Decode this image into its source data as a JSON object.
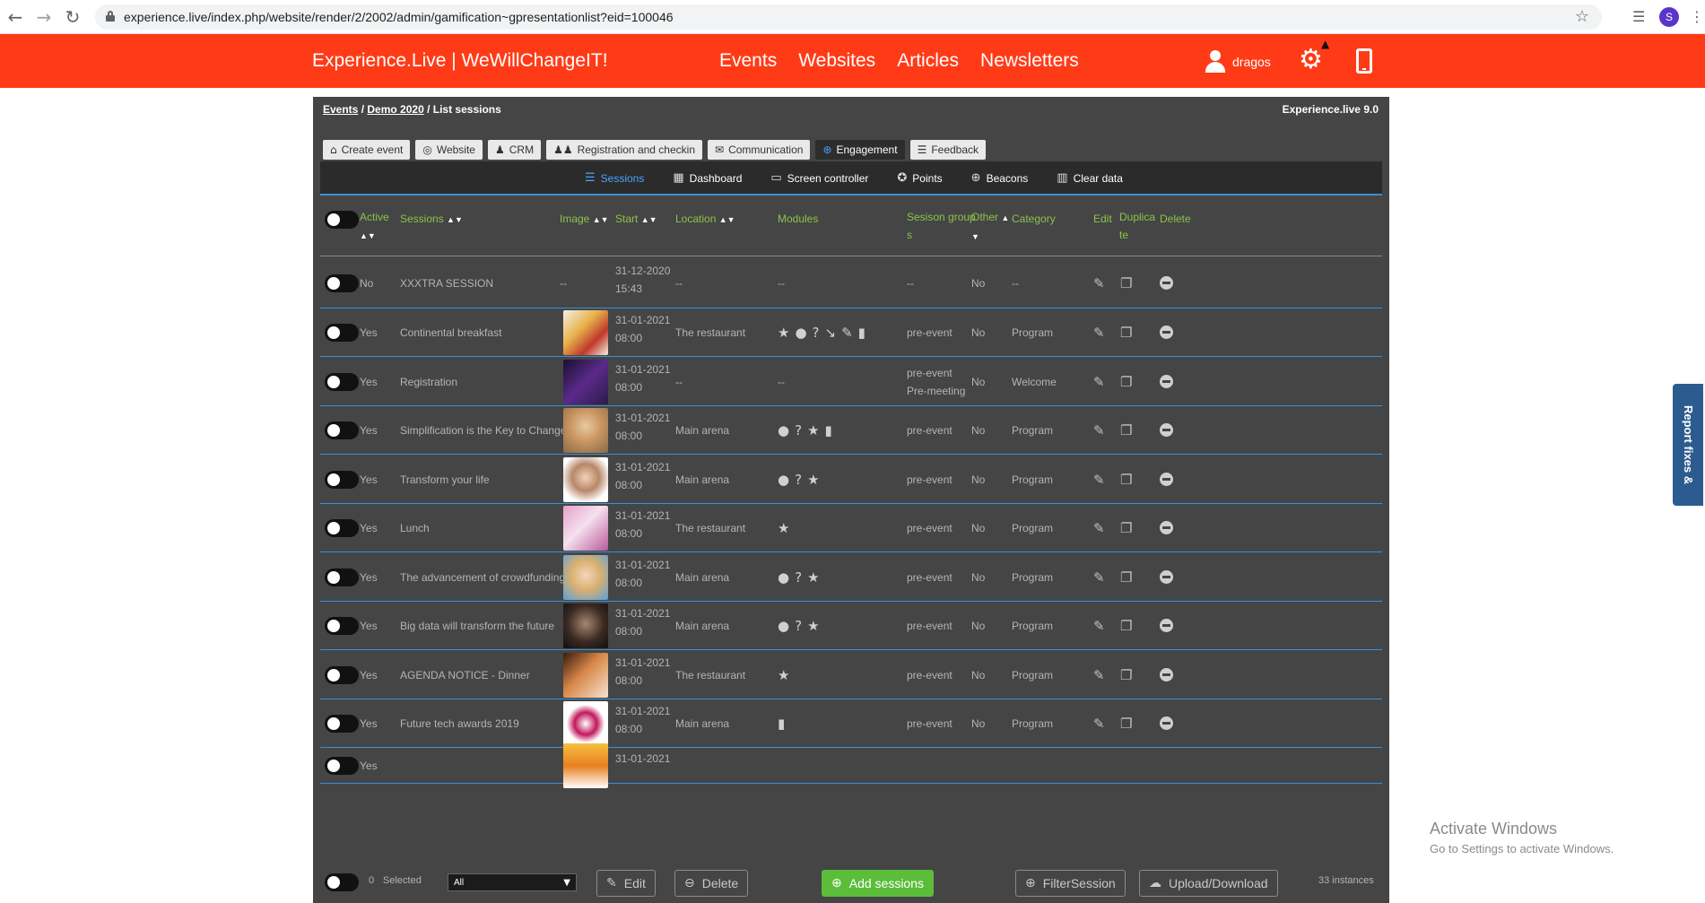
{
  "browser": {
    "url": "experience.live/index.php/website/render/2/2002/admin/gamification~gpresentationlist?eid=100046",
    "profile_initial": "S"
  },
  "header": {
    "brand": "Experience.Live | WeWillChangeIT!",
    "nav": [
      "Events",
      "Websites",
      "Articles",
      "Newsletters"
    ],
    "username": "dragos"
  },
  "breadcrumb": {
    "events": "Events",
    "sep1": " / ",
    "demo": "Demo 2020",
    "sep2": " / ",
    "current": "List sessions",
    "version": "Experience.live 9.0"
  },
  "tabs": [
    {
      "label": "Create event",
      "icon": "house-icon",
      "glyph": "⌂"
    },
    {
      "label": "Website",
      "icon": "globe-icon",
      "glyph": "◎"
    },
    {
      "label": "CRM",
      "icon": "user-icon",
      "glyph": "♟"
    },
    {
      "label": "Registration and checkin",
      "icon": "people-icon",
      "glyph": "♟♟"
    },
    {
      "label": "Communication",
      "icon": "envelope-icon",
      "glyph": "✉"
    },
    {
      "label": "Engagement",
      "icon": "gamepad-icon",
      "glyph": "⊛",
      "active": true
    },
    {
      "label": "Feedback",
      "icon": "list-icon",
      "glyph": "☰"
    }
  ],
  "subnav": [
    {
      "label": "Sessions",
      "icon": "list-icon",
      "glyph": "☰",
      "active": true
    },
    {
      "label": "Dashboard",
      "icon": "dashboard-icon",
      "glyph": "▦"
    },
    {
      "label": "Screen controller",
      "icon": "laptop-icon",
      "glyph": "▭"
    },
    {
      "label": "Points",
      "icon": "trophy-icon",
      "glyph": "✪"
    },
    {
      "label": "Beacons",
      "icon": "target-icon",
      "glyph": "⊕"
    },
    {
      "label": "Clear data",
      "icon": "trash-icon",
      "glyph": "▥"
    }
  ],
  "columns": {
    "active": "Active",
    "sessions": "Sessions",
    "image": "Image",
    "start": "Start",
    "location": "Location",
    "modules": "Modules",
    "session_group_1": "Sesison group",
    "session_group_2": "s",
    "other": "Other",
    "category": "Category",
    "edit": "Edit",
    "duplicate_1": "Duplica",
    "duplicate_2": "te",
    "delete": "Delete"
  },
  "rows": [
    {
      "active": "No",
      "name": "XXXTRA SESSION",
      "image": "--",
      "date": "31-12-2020",
      "time": "15:43",
      "location": "--",
      "modules": [
        "--"
      ],
      "group": "--",
      "group2": "",
      "other": "No",
      "category": "--"
    },
    {
      "active": "Yes",
      "name": "Continental breakfast",
      "image": "breakfast",
      "date": "31-01-2021",
      "time": "08:00",
      "location": "The restaurant",
      "modules": [
        "★",
        "●",
        "?",
        "↘",
        "✎",
        "▮"
      ],
      "group": "pre-event",
      "group2": "",
      "other": "No",
      "category": "Program"
    },
    {
      "active": "Yes",
      "name": "Registration",
      "image": "phone",
      "date": "31-01-2021",
      "time": "08:00",
      "location": "--",
      "modules": [
        "--"
      ],
      "group": "pre-event",
      "group2": "Pre-meeting",
      "other": "No",
      "category": "Welcome"
    },
    {
      "active": "Yes",
      "name": "Simplification is the Key to Change",
      "image": "woman",
      "date": "31-01-2021",
      "time": "08:00",
      "location": "Main arena",
      "modules": [
        "●",
        "?",
        "★",
        "▮"
      ],
      "group": "pre-event",
      "group2": "",
      "other": "No",
      "category": "Program"
    },
    {
      "active": "Yes",
      "name": "Transform your life",
      "image": "man",
      "date": "31-01-2021",
      "time": "08:00",
      "location": "Main arena",
      "modules": [
        "●",
        "?",
        "★"
      ],
      "group": "pre-event",
      "group2": "",
      "other": "No",
      "category": "Program"
    },
    {
      "active": "Yes",
      "name": "Lunch",
      "image": "lunch",
      "date": "31-01-2021",
      "time": "08:00",
      "location": "The restaurant",
      "modules": [
        "★"
      ],
      "group": "pre-event",
      "group2": "",
      "other": "No",
      "category": "Program"
    },
    {
      "active": "Yes",
      "name": "The advancement of crowdfunding",
      "image": "blonde",
      "date": "31-01-2021",
      "time": "08:00",
      "location": "Main arena",
      "modules": [
        "●",
        "?",
        "★"
      ],
      "group": "pre-event",
      "group2": "",
      "other": "No",
      "category": "Program"
    },
    {
      "active": "Yes",
      "name": "Big data will transform the future",
      "image": "dark",
      "date": "31-01-2021",
      "time": "08:00",
      "location": "Main arena",
      "modules": [
        "●",
        "?",
        "★"
      ],
      "group": "pre-event",
      "group2": "",
      "other": "No",
      "category": "Program"
    },
    {
      "active": "Yes",
      "name": "AGENDA NOTICE - Dinner",
      "image": "dinner",
      "date": "31-01-2021",
      "time": "08:00",
      "location": "The restaurant",
      "modules": [
        "★"
      ],
      "group": "pre-event",
      "group2": "",
      "other": "No",
      "category": "Program"
    },
    {
      "active": "Yes",
      "name": "Future tech awards 2019",
      "image": "award",
      "date": "31-01-2021",
      "time": "08:00",
      "location": "Main arena",
      "modules": [
        "▮"
      ],
      "group": "pre-event",
      "group2": "",
      "other": "No",
      "category": "Program"
    },
    {
      "active": "Yes",
      "name": "",
      "image": "sunset",
      "date": "31-01-2021",
      "time": "",
      "location": "",
      "modules": [],
      "group": "",
      "group2": "",
      "other": "",
      "category": ""
    }
  ],
  "footer": {
    "selected_count": "0",
    "selected_label": "Selected",
    "dropdown_value": "All",
    "edit": "Edit",
    "delete": "Delete",
    "add_sessions": "Add sessions",
    "filter": "FilterSession",
    "upload": "Upload/Download",
    "instances": "33 instances"
  },
  "side_tab": "Report fixes & dreams",
  "windows_notice": {
    "title": "Activate Windows",
    "subtitle": "Go to Settings to activate Windows."
  },
  "colors": {
    "header": "#ff3b17",
    "panel": "#454545",
    "column_header": "#8bc34a",
    "row_divider": "#3b8fd8",
    "add_button": "#5cbd3b"
  }
}
